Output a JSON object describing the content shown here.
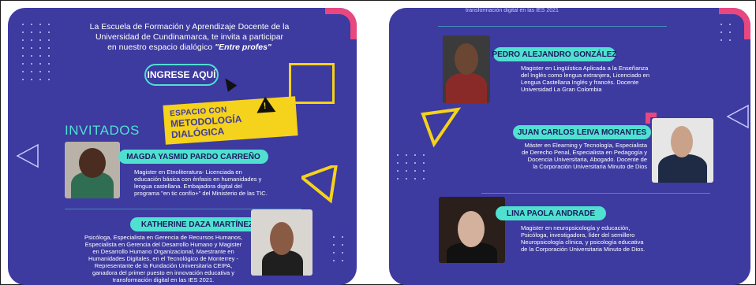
{
  "intro": {
    "line1": "La Escuela de Formación y Aprendizaje Docente de la",
    "line2": "Universidad de Cundinamarca, te invita a participar",
    "line3_prefix": "en nuestro espacio dialógico ",
    "line3_bold": "\"Entre profes\""
  },
  "cta": {
    "label": "INGRESE AQUÍ"
  },
  "banner": {
    "line1": "ESPACIO CON",
    "line2": "METODOLOGÍA DIALÓGICA"
  },
  "section_title": "INVITADOS",
  "top_fragment": "transformación digital en las IES 2021",
  "guests": [
    {
      "name": "MAGDA YASMID PARDO CARREÑO",
      "bio": [
        "Magister en Etnoliteratura- Licenciada en",
        "educación básica con énfasis en humanidades y",
        "lengua castellana. Embajadora digital del",
        "programa \"en tic confío+\" del Ministerio de las TIC."
      ]
    },
    {
      "name": "KATHERINE DAZA MARTÍNEZ",
      "bio": [
        "Psicóloga, Especialista en Gerencia de Recursos Humanos,",
        "Especialista en Gerencia del Desarrollo Humano y Magister",
        "en Desarrollo Humano Organizacional, Maestrante en",
        "Humanidades Digitales, en el Tecnológico de Monterrey -",
        "Representante de la Fundación Universitaria CEIPA,",
        "ganadora del primer puesto en innovación educativa y",
        "transformación digital en las IES 2021."
      ]
    },
    {
      "name": "PEDRO ALEJANDRO GONZÁLEZ",
      "bio": [
        "Magister en Lingüística Aplicada a la Enseñanza",
        "del Inglés como lengua extranjera, Licenciado en",
        "Lengua Castellana Inglés y francés. Docente",
        "Universidad La Gran Colombia"
      ]
    },
    {
      "name": "JUAN CARLOS LEIVA MORANTES",
      "bio": [
        "Máster en Elearning y Tecnología, Especialista",
        "de Derecho Penal, Especialista en Pedagogía y",
        "Docencia Universitaria,  Abogado. Docente de",
        "la Corporación Universitaria Minuto de Dios"
      ]
    },
    {
      "name": "LINA PAOLA ANDRADE",
      "bio": [
        "Magister en neuropsicología y educación,",
        "Psicóloga, investigadora, líder del semillero",
        "Neuropsicología clínica, y psicología educativa",
        "de la Corporación Universitaria Minuto de Dios."
      ]
    }
  ],
  "colors": {
    "panel": "#3d3aa0",
    "accent": "#4fe0d0",
    "yellow": "#f5d21b",
    "pink": "#e8477f"
  }
}
